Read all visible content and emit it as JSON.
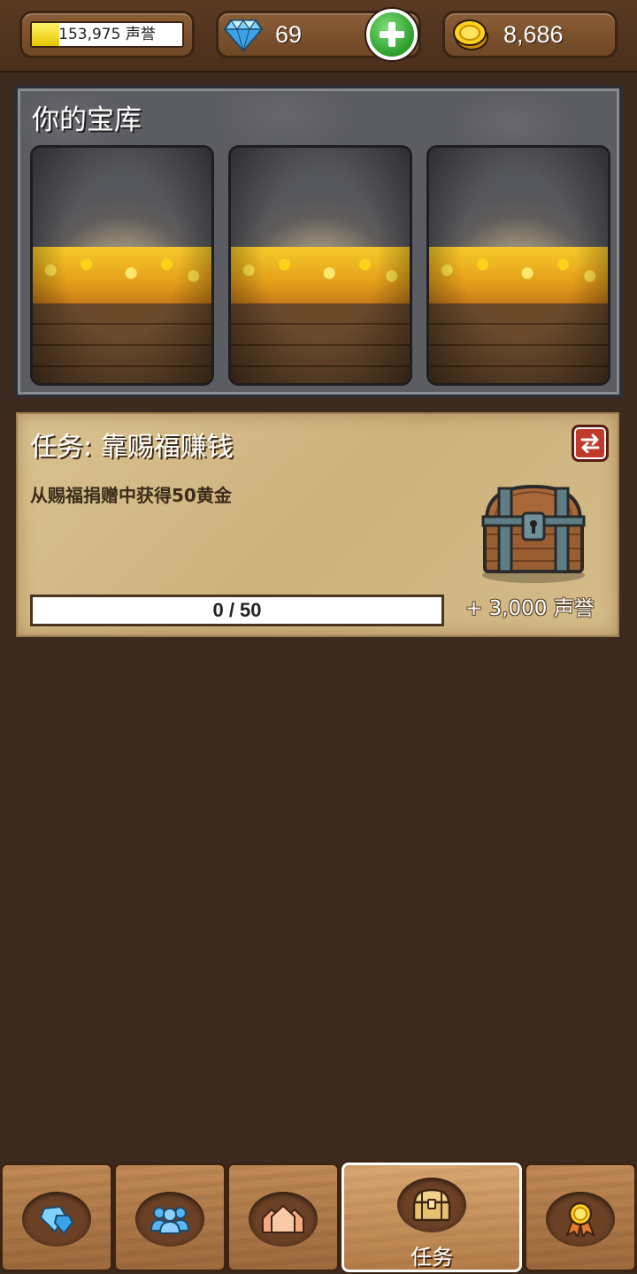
{
  "top_bar": {
    "reputation": {
      "text": "153,975 声誉",
      "fill_fraction": 0.18
    },
    "gems": {
      "value": "69"
    },
    "gold": {
      "value": "8,686"
    }
  },
  "vault": {
    "title": "你的宝库",
    "slots": 3
  },
  "task": {
    "title": "任务: 靠赐福赚钱",
    "description": "从赐福捐赠中获得50黄金",
    "progress_text": "0 / 50",
    "progress_fraction": 0,
    "reward": "+ 3,000 声誉"
  },
  "nav": {
    "tabs": [
      {
        "icon": "gem-icon"
      },
      {
        "icon": "people-icon"
      },
      {
        "icon": "houses-icon"
      },
      {
        "icon": "chest-icon",
        "label": "任务",
        "active": true
      },
      {
        "icon": "medal-icon"
      }
    ]
  },
  "colors": {
    "background": "#3d2a1e",
    "parchment": "#d4bb88",
    "rep_fill": "#f0d400",
    "add_button": "#2a9d2a",
    "swap_button": "#c0392b"
  }
}
